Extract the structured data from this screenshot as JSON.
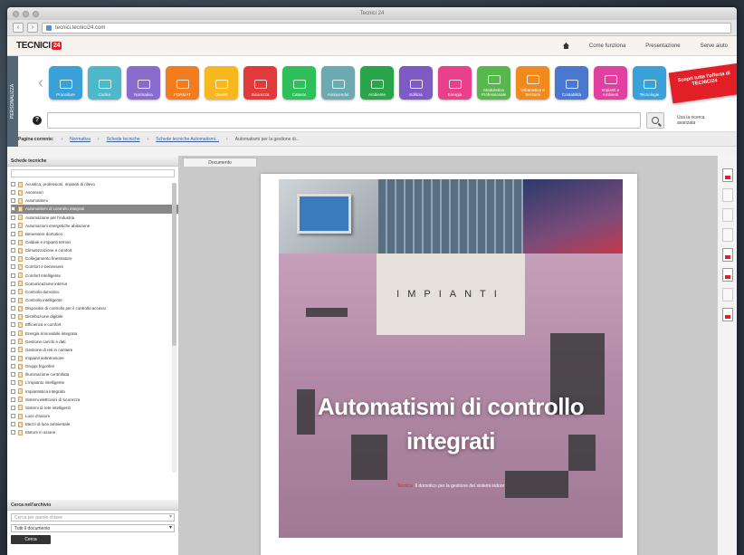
{
  "window": {
    "title": "Tecnici 24"
  },
  "browser": {
    "url": "tecnici.tecnici24.com"
  },
  "header": {
    "logo_text": "TECNICI",
    "logo_badge": "24",
    "menu": [
      "Come funziona",
      "Presentazione",
      "Serve aiuto"
    ]
  },
  "sidetab": {
    "label": "PERSONALIZZA"
  },
  "tiles": [
    {
      "label": "Procedure",
      "color": "#3aa0d8"
    },
    {
      "label": "Codice",
      "color": "#4db8c9"
    },
    {
      "label": "Normativa",
      "color": "#8a6ccc"
    },
    {
      "label": "FORMAT",
      "color": "#f27c1e"
    },
    {
      "label": "Quesiti",
      "color": "#f6b81c"
    },
    {
      "label": "Sicurezza",
      "color": "#e23a3a"
    },
    {
      "label": "Catasto",
      "color": "#2fbf5a"
    },
    {
      "label": "Antincendio",
      "color": "#6aaab0"
    },
    {
      "label": "Ambiente",
      "color": "#2aa44a"
    },
    {
      "label": "Edilizia",
      "color": "#7e5bc4"
    },
    {
      "label": "Energia",
      "color": "#e8408a"
    },
    {
      "label": "Modulistica Professionale",
      "color": "#56b84a"
    },
    {
      "label": "Urbanistica e Territorio",
      "color": "#f08a1e"
    },
    {
      "label": "Contabilità",
      "color": "#4a78d0"
    },
    {
      "label": "Impianti e Ambienti",
      "color": "#e040a0"
    },
    {
      "label": "Tecnologie",
      "color": "#3aa0d8"
    }
  ],
  "promo": {
    "label": "Scopri tutte l'offerta di TECNICI24"
  },
  "search": {
    "help": "?",
    "advanced": "Usa la ricerca avanzata"
  },
  "breadcrumbs": {
    "label": "Pagina corrente:",
    "items": [
      "Normativa",
      "Schede tecniche",
      "Schede tecniche Automatismi...",
      "Automatismi per la gestione di..."
    ]
  },
  "leftpanel": {
    "title": "Schede tecniche",
    "tree": [
      "Acustica, professioni, impianti di rilievo",
      "Ascensori",
      "Automatismi",
      "Automatismi di controllo integrati",
      "Automazione per l'industria",
      "Automazioni energetiche abitazione",
      "Benessere domotico",
      "Caldaie e impianti termici",
      "Climatizzazione e comfort",
      "Collegamento finestrature",
      "Comfort e benessere",
      "Comfort Intelligente",
      "Comunicazione interna",
      "Controllo domotico",
      "Controllo intelligente",
      "Dispositivi di controllo per il controllo accessi",
      "Distribuzione digitale",
      "Efficienza e comfort",
      "Energia rinnovabile integrata",
      "Gestione carichi e dati",
      "Gestione di reti in cantiere",
      "Impianti antintrusione",
      "Gruppi frigoriferi",
      "Illuminazione controllata",
      "L'impianto intelligente",
      "Impiantistica integrata",
      "Sistemi elettronici di sicurezza",
      "Sistemi di rete intelligenti",
      "Luce d'autore",
      "Mezzi di luce ambientale",
      "Motore in azione"
    ],
    "selected_index": 3,
    "bottom_title": "Cerca nell'archivio",
    "filter_placeholder": "Cerca per parole chiave",
    "select_value": "Tutti il documento",
    "button_label": "Cerca"
  },
  "document": {
    "tab_label": "Documento",
    "cover_label": "IMPIANTI",
    "cover_title_line1": "Automatismi di controllo",
    "cover_title_line2": "integrati",
    "cover_subtitle_tag": "Tecnica",
    "cover_subtitle": "Il domotico per la gestione dei sistemi indoor"
  }
}
